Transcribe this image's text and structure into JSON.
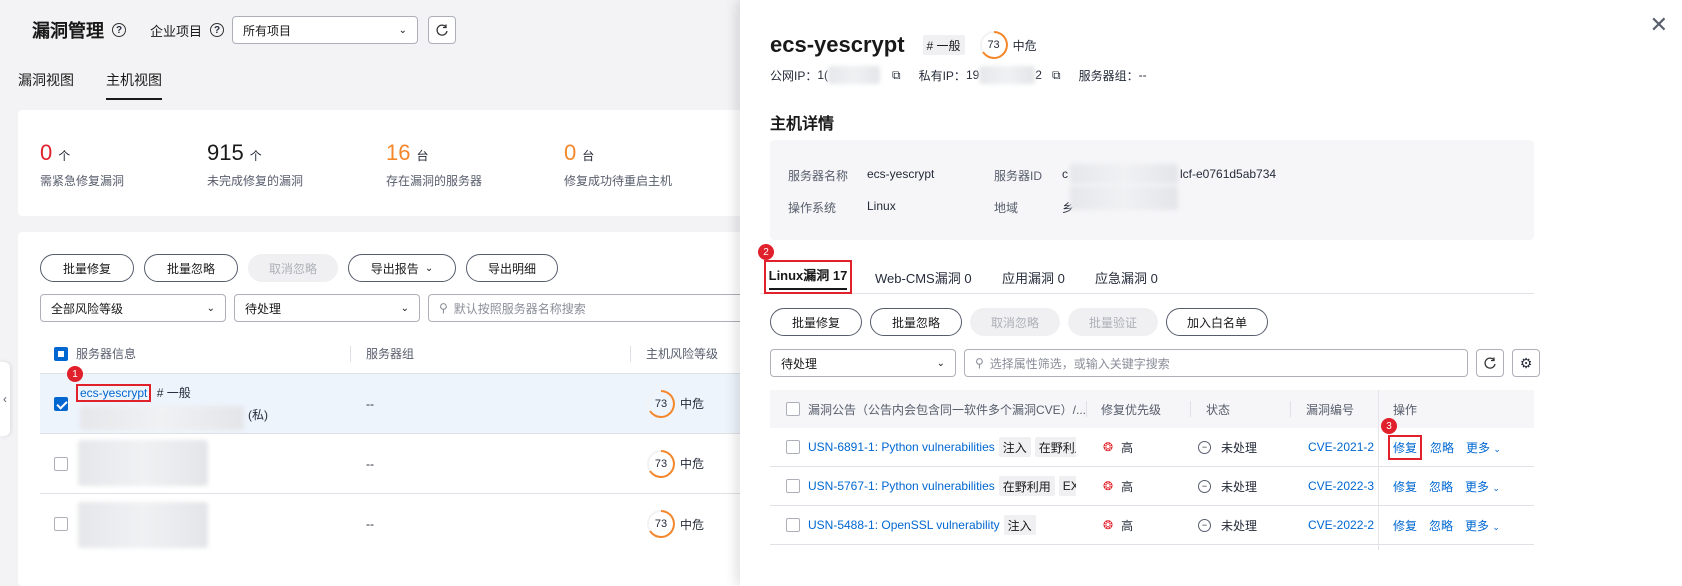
{
  "header": {
    "title": "漏洞管理",
    "enterprise_label": "企业项目",
    "project_select": "所有项目"
  },
  "tabs": [
    "漏洞视图",
    "主机视图"
  ],
  "stats": [
    {
      "num": "0",
      "unit": "个",
      "desc": "需紧急修复漏洞",
      "color": "#e0202a"
    },
    {
      "num": "915",
      "unit": "个",
      "desc": "未完成修复的漏洞",
      "color": "#191919"
    },
    {
      "num": "16",
      "unit": "台",
      "desc": "存在漏洞的服务器",
      "color": "#f5872b"
    },
    {
      "num": "0",
      "unit": "台",
      "desc": "修复成功待重启主机",
      "color": "#f5872b"
    }
  ],
  "left_toolbar": {
    "batch_fix": "批量修复",
    "batch_ignore": "批量忽略",
    "cancel_ignore": "取消忽略",
    "export_report": "导出报告",
    "export_detail": "导出明细"
  },
  "left_filters": {
    "risk_level": "全部风险等级",
    "status": "待处理",
    "search_placeholder": "默认按照服务器名称搜索"
  },
  "left_table": {
    "headers": [
      "服务器信息",
      "服务器组",
      "主机风险等级"
    ],
    "rows": [
      {
        "name": "ecs-yescrypt",
        "tag": "# 一般",
        "ip_suffix": "(私)",
        "group": "--",
        "score": "73",
        "level": "中危",
        "checked": true
      },
      {
        "name": "",
        "tag": "",
        "ip_suffix": "",
        "group": "--",
        "score": "73",
        "level": "中危",
        "checked": false
      },
      {
        "name": "",
        "tag": "",
        "ip_suffix": "",
        "group": "--",
        "score": "73",
        "level": "中危",
        "checked": false
      }
    ]
  },
  "drawer": {
    "title": "ecs-yescrypt",
    "tag": "# 一般",
    "score": "73",
    "level": "中危",
    "public_ip_label": "公网IP：",
    "public_ip_prefix": "1(",
    "private_ip_label": "私有IP：",
    "private_ip_prefix": "19",
    "private_ip_suffix": "2",
    "server_group_label": "服务器组：",
    "server_group": "--",
    "detail_title": "主机详情",
    "details": {
      "server_name_label": "服务器名称",
      "server_name": "ecs-yescrypt",
      "server_id_label": "服务器ID",
      "server_id_prefix": "c",
      "server_id_suffix": "lcf-e0761d5ab734",
      "os_label": "操作系统",
      "os": "Linux",
      "region_label": "地域",
      "region_prefix": "乡"
    },
    "vuln_tabs": [
      "Linux漏洞 17",
      "Web-CMS漏洞 0",
      "应用漏洞 0",
      "应急漏洞 0"
    ],
    "toolbar": {
      "batch_fix": "批量修复",
      "batch_ignore": "批量忽略",
      "cancel_ignore": "取消忽略",
      "batch_verify": "批量验证",
      "add_whitelist": "加入白名单"
    },
    "status_filter": "待处理",
    "search_placeholder": "选择属性筛选，或输入关键字搜索",
    "table_headers": [
      "漏洞公告（公告内会包含同一软件多个漏洞CVE）/...",
      "修复优先级",
      "状态",
      "漏洞编号",
      "操作"
    ],
    "rows": [
      {
        "name": "USN-6891-1: Python vulnerabilities",
        "tags": [
          "注入",
          "在野利用"
        ],
        "priority": "高",
        "status": "未处理",
        "cve": "CVE-2021-2",
        "fix": "修复",
        "ignore": "忽略",
        "more": "更多"
      },
      {
        "name": "USN-5767-1: Python vulnerabilities",
        "tags": [
          "在野利用",
          "EXP/"
        ],
        "priority": "高",
        "status": "未处理",
        "cve": "CVE-2022-3",
        "fix": "修复",
        "ignore": "忽略",
        "more": "更多"
      },
      {
        "name": "USN-5488-1: OpenSSL vulnerability",
        "tags": [
          "注入"
        ],
        "priority": "高",
        "status": "未处理",
        "cve": "CVE-2022-2",
        "fix": "修复",
        "ignore": "忽略",
        "more": "更多"
      }
    ]
  },
  "callouts": [
    "1",
    "2",
    "3"
  ]
}
